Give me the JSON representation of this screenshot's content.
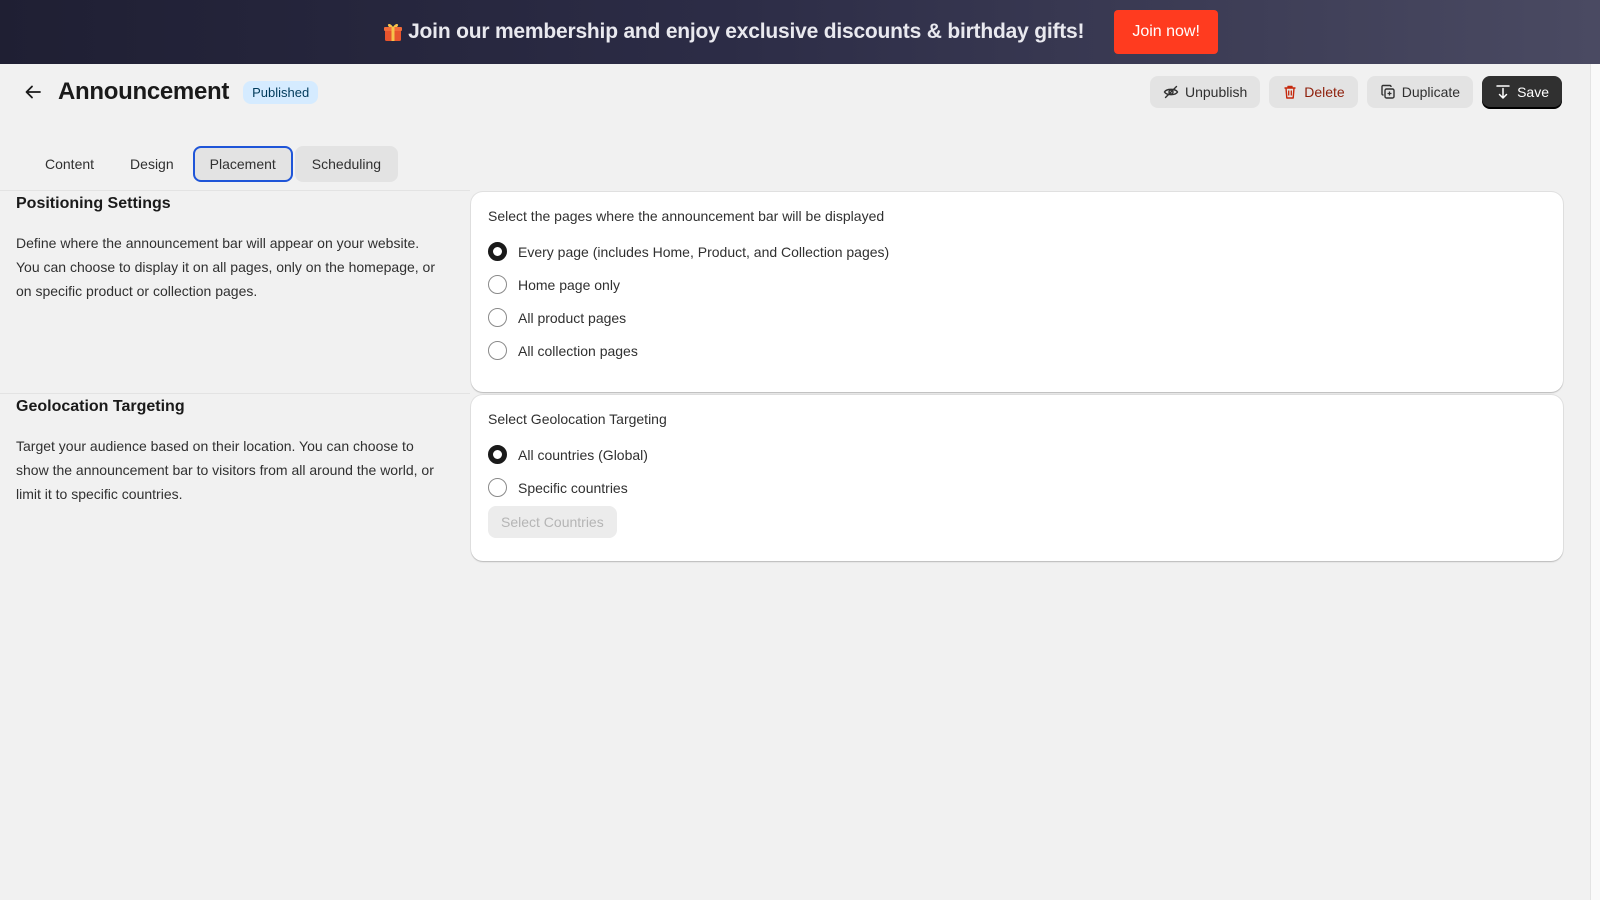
{
  "promo": {
    "text": "Join our membership and enjoy exclusive discounts & birthday gifts!",
    "button_label": "Join now!",
    "icon": "gift-icon"
  },
  "header": {
    "title": "Announcement",
    "status": "Published",
    "actions": {
      "unpublish": "Unpublish",
      "delete": "Delete",
      "duplicate": "Duplicate",
      "save": "Save"
    }
  },
  "tabs": [
    {
      "label": "Content"
    },
    {
      "label": "Design"
    },
    {
      "label": "Placement",
      "active": true
    },
    {
      "label": "Scheduling"
    }
  ],
  "positioning": {
    "title": "Positioning Settings",
    "description": "Define where the announcement bar will appear on your website. You can choose to display it on all pages, only on the homepage, or on specific product or collection pages.",
    "card_label": "Select the pages where the announcement bar will be displayed",
    "options": [
      {
        "label": "Every page (includes Home, Product, and Collection pages)",
        "selected": true
      },
      {
        "label": "Home page only",
        "selected": false
      },
      {
        "label": "All product pages",
        "selected": false
      },
      {
        "label": "All collection pages",
        "selected": false
      }
    ]
  },
  "geolocation": {
    "title": "Geolocation Targeting",
    "description": "Target your audience based on their location. You can choose to show the announcement bar to visitors from all around the world, or limit it to specific countries.",
    "card_label": "Select Geolocation Targeting",
    "options": [
      {
        "label": "All countries (Global)",
        "selected": true
      },
      {
        "label": "Specific countries",
        "selected": false
      }
    ],
    "select_button": "Select Countries"
  },
  "colors": {
    "accent": "#1f55d8",
    "promo_button": "#ff3b1f",
    "badge_bg": "#d5ebff",
    "delete_text": "#8e1f0b"
  }
}
